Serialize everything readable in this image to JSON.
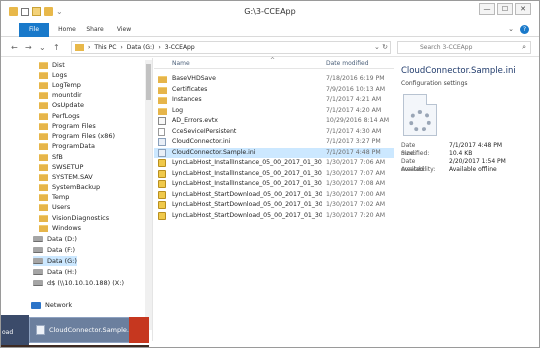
{
  "window": {
    "title": "G:\\3-CCEApp",
    "controls": {
      "minimize": "—",
      "maximize": "☐",
      "close": "✕"
    }
  },
  "ribbon": {
    "tabs": [
      "File",
      "Home",
      "Share",
      "View"
    ],
    "expand_glyph": "⌄",
    "help_glyph": "?"
  },
  "address": {
    "back": "←",
    "forward": "→",
    "dropdown": "⌄",
    "up": "↑",
    "crumbs": [
      "This PC",
      "Data (G:)",
      "3-CCEApp"
    ],
    "separator": "›",
    "refresh": "↻",
    "search_placeholder": "Search 3-CCEApp",
    "search_icon": "⌕"
  },
  "nav": {
    "items": [
      {
        "label": "Dist",
        "kind": "folder"
      },
      {
        "label": "Logs",
        "kind": "folder"
      },
      {
        "label": "LogTemp",
        "kind": "folder"
      },
      {
        "label": "mountdir",
        "kind": "folder"
      },
      {
        "label": "OsUpdate",
        "kind": "folder"
      },
      {
        "label": "PerfLogs",
        "kind": "folder"
      },
      {
        "label": "Program Files",
        "kind": "folder"
      },
      {
        "label": "Program Files (x86)",
        "kind": "folder"
      },
      {
        "label": "ProgramData",
        "kind": "folder"
      },
      {
        "label": "SfB",
        "kind": "folder"
      },
      {
        "label": "SWSETUP",
        "kind": "folder"
      },
      {
        "label": "SYSTEM.SAV",
        "kind": "folder"
      },
      {
        "label": "SystemBackup",
        "kind": "folder"
      },
      {
        "label": "Temp",
        "kind": "folder"
      },
      {
        "label": "Users",
        "kind": "folder"
      },
      {
        "label": "VisionDiagnostics",
        "kind": "folder"
      },
      {
        "label": "Windows",
        "kind": "folder"
      },
      {
        "label": "Data (D:)",
        "kind": "drive"
      },
      {
        "label": "Data (F:)",
        "kind": "drive"
      },
      {
        "label": "Data (G:)",
        "kind": "drive",
        "selected": true
      },
      {
        "label": "Data (H:)",
        "kind": "drive"
      },
      {
        "label": "d$ (\\\\10.10.10.188) (X:)",
        "kind": "drive"
      },
      {
        "label": "Network",
        "kind": "network"
      }
    ]
  },
  "files": {
    "columns": {
      "name": "Name",
      "date": "Date modified",
      "sort_glyph": "^"
    },
    "rows": [
      {
        "name": "BaseVHDSave",
        "date": "7/18/2016 6:19 PM",
        "kind": "folder"
      },
      {
        "name": "Certificates",
        "date": "7/9/2016 10:13 AM",
        "kind": "folder"
      },
      {
        "name": "Instances",
        "date": "7/1/2017 4:21 AM",
        "kind": "folder"
      },
      {
        "name": "Log",
        "date": "7/1/2017 4:20 AM",
        "kind": "folder"
      },
      {
        "name": "AD_Errors.evtx",
        "date": "10/29/2016 8:14 AM",
        "kind": "evtx"
      },
      {
        "name": "CceSeviceIPersistent",
        "date": "7/1/2017 4:30 AM",
        "kind": "doc"
      },
      {
        "name": "CloudConnector.ini",
        "date": "7/1/2017 3:27 PM",
        "kind": "cfg"
      },
      {
        "name": "CloudConnector.Sample.ini",
        "date": "7/1/2017 4:48 PM",
        "kind": "cfg",
        "selected": true
      },
      {
        "name": "LyncLabHost_InstallInstance_05_00_2017_01_30_07_06...",
        "date": "1/30/2017 7:06 AM",
        "kind": "log"
      },
      {
        "name": "LyncLabHost_InstallInstance_05_00_2017_01_30_07_0...",
        "date": "1/30/2017 7:07 AM",
        "kind": "log"
      },
      {
        "name": "LyncLabHost_InstallInstance_05_00_2017_01_30_07_08...",
        "date": "1/30/2017 7:08 AM",
        "kind": "log"
      },
      {
        "name": "LyncLabHost_StartDownload_05_00_2017_01_30_07_00...",
        "date": "1/30/2017 7:00 AM",
        "kind": "log"
      },
      {
        "name": "LyncLabHost_StartDownload_05_00_2017_01_30_07_0...",
        "date": "1/30/2017 7:02 AM",
        "kind": "log"
      },
      {
        "name": "LyncLabHost_StartDownload_05_00_2017_01_30_07_2...",
        "date": "1/30/2017 7:20 AM",
        "kind": "log"
      }
    ]
  },
  "preview": {
    "title": "CloudConnector.Sample.ini",
    "subtitle": "Configuration settings",
    "props": [
      {
        "key": "Date modified:",
        "value": "7/1/2017 4:48 PM"
      },
      {
        "key": "Size:",
        "value": "10.4 KB"
      },
      {
        "key": "Date created:",
        "value": "2/20/2017 1:54 PM"
      },
      {
        "key": "Availability:",
        "value": "Available offline"
      }
    ]
  },
  "taskbar": {
    "left_label": "oad",
    "active_task": "CloudConnector.Sample.ini ..."
  }
}
